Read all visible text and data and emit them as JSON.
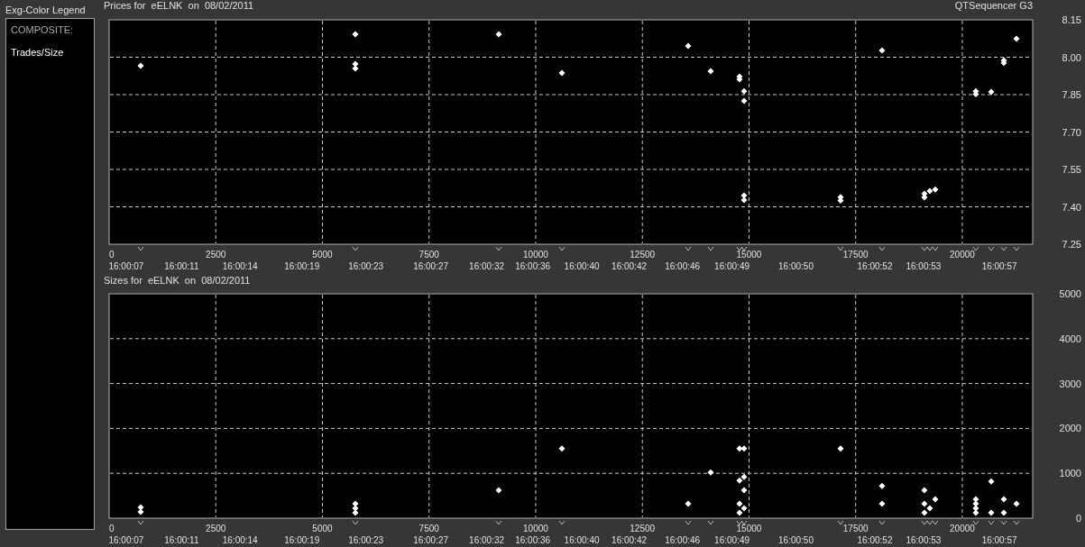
{
  "legend": {
    "title": "Exg-Color Legend",
    "heading": "COMPOSITE:",
    "items": [
      "Trades/Size"
    ]
  },
  "app_name": "QTSequencer G3",
  "charts": [
    {
      "title": "Prices for  eELNK  on  08/02/2011",
      "time_labels": [
        "16:00:07",
        "16:00:11",
        "16:00:14",
        "16:00:19",
        "16:00:23",
        "16:00:27",
        "16:00:32",
        "16:00:36",
        "16:00:40",
        "16:00:42",
        "16:00:46",
        "16:00:49",
        "16:00:50",
        "16:00:52",
        "16:00:53",
        "16:00:57"
      ],
      "chart_data": {
        "type": "scatter",
        "grid": true,
        "xlim": [
          0,
          21650
        ],
        "ylim": [
          7.25,
          8.15
        ],
        "xticks": [
          0,
          2500,
          5000,
          7500,
          10000,
          12500,
          15000,
          17500,
          20000
        ],
        "yticks": [
          {
            "value": 7.25,
            "label": "7.25"
          },
          {
            "value": 7.4,
            "label": "7.40"
          },
          {
            "value": 7.55,
            "label": "7.55"
          },
          {
            "value": 7.7,
            "label": "7.70"
          },
          {
            "value": 7.85,
            "label": "7.85"
          },
          {
            "value": 8.0,
            "label": "8.00"
          },
          {
            "value": 8.15,
            "label": "8.15"
          }
        ],
        "x": [
          740,
          5772,
          5772,
          5772,
          9133,
          10613,
          13573,
          14101,
          14778,
          14778,
          14884,
          14884,
          14884,
          14884,
          17146,
          17146,
          18118,
          19112,
          19112,
          19239,
          19366,
          20317,
          20317,
          20677,
          20973,
          20973,
          21269
        ],
        "series": [
          {
            "color": "#ffffff",
            "values": [
              7.966,
              8.092,
              7.973,
              7.955,
              8.092,
              7.937,
              8.045,
              7.944,
              7.922,
              7.911,
              7.864,
              7.825,
              7.445,
              7.427,
              7.439,
              7.425,
              8.027,
              7.452,
              7.438,
              7.463,
              7.47,
              7.864,
              7.852,
              7.861,
              7.977,
              7.987,
              8.074
            ]
          }
        ]
      }
    },
    {
      "title": "Sizes for  eELNK  on  08/02/2011",
      "time_labels": [
        "16:00:07",
        "16:00:11",
        "16:00:14",
        "16:00:19",
        "16:00:23",
        "16:00:27",
        "16:00:32",
        "16:00:36",
        "16:00:40",
        "16:00:42",
        "16:00:46",
        "16:00:49",
        "16:00:50",
        "16:00:52",
        "16:00:53",
        "16:00:57"
      ],
      "chart_data": {
        "type": "scatter",
        "grid": true,
        "xlim": [
          0,
          21650
        ],
        "ylim": [
          0,
          5000
        ],
        "xticks": [
          0,
          2500,
          5000,
          7500,
          10000,
          12500,
          15000,
          17500,
          20000
        ],
        "yticks": [
          0,
          1000,
          2000,
          3000,
          4000,
          5000
        ],
        "x": [
          740,
          740,
          5772,
          5772,
          5772,
          9133,
          10613,
          13573,
          14101,
          14778,
          14778,
          14884,
          14884,
          14884,
          14778,
          14884,
          14778,
          17146,
          18118,
          18118,
          19112,
          19112,
          19112,
          19239,
          19366,
          20317,
          20317,
          20317,
          20317,
          20677,
          20677,
          20973,
          20973,
          21269
        ],
        "series": [
          {
            "color": "#ffffff",
            "values": [
              240,
              140,
              320,
              220,
              120,
              620,
              1550,
              320,
              1020,
              840,
              1550,
              1550,
              920,
              620,
              320,
              220,
              120,
              1550,
              720,
              320,
              620,
              320,
              120,
              220,
              420,
              420,
              320,
              220,
              120,
              820,
              120,
              420,
              120,
              320
            ]
          }
        ]
      }
    }
  ]
}
